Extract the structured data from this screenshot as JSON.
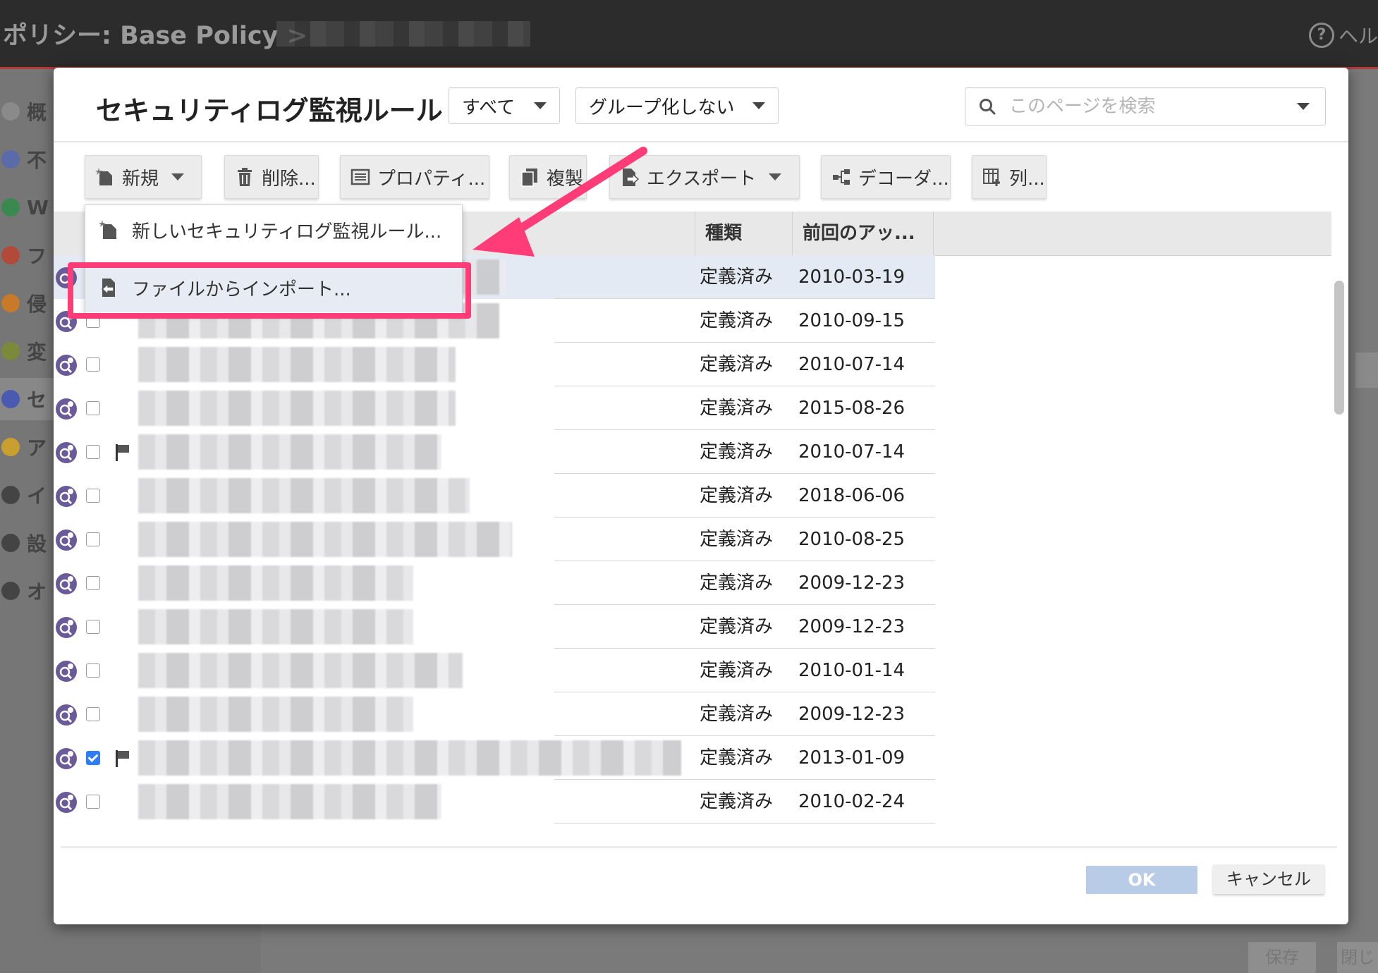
{
  "app": {
    "title": "ポリシー: Base Policy >",
    "help_label": "ヘル",
    "sidebar": [
      {
        "label": "概",
        "color": "#8a8a8a"
      },
      {
        "label": "不",
        "color": "#5b6aa8"
      },
      {
        "label": "W",
        "color": "#3a8a50"
      },
      {
        "label": "フ",
        "color": "#b24a3a"
      },
      {
        "label": "侵",
        "color": "#c77a2a"
      },
      {
        "label": "変",
        "color": "#7a8a3a"
      },
      {
        "label": "セ",
        "color": "#4a5ab0"
      },
      {
        "label": "ア",
        "color": "#c9a030"
      },
      {
        "label": "イ",
        "color": "#444444"
      },
      {
        "label": "設",
        "color": "#444444"
      },
      {
        "label": "オ",
        "color": "#444444"
      }
    ],
    "bottom_buttons": {
      "save": "保存",
      "close": "閉じ"
    }
  },
  "modal": {
    "title": "セキュリティログ監視ルール",
    "filter_label": "すべて",
    "group_label": "グループ化しない",
    "search_placeholder": "このページを検索",
    "toolbar": {
      "new": "新規",
      "delete": "削除...",
      "properties": "プロパティ...",
      "duplicate": "複製",
      "export": "エクスポート",
      "decoder": "デコーダ...",
      "columns": "列..."
    },
    "menu": {
      "new_rule": "新しいセキュリティログ監視ルール...",
      "import_from_file": "ファイルからインポート..."
    },
    "columns": {
      "type": "種類",
      "last_updated": "前回のアッ..."
    },
    "rows": [
      {
        "type": "定義済み",
        "date": "2010-03-19",
        "checked": false,
        "flag": false,
        "selected": true
      },
      {
        "type": "定義済み",
        "date": "2010-09-15",
        "checked": false,
        "flag": false
      },
      {
        "type": "定義済み",
        "date": "2010-07-14",
        "checked": false,
        "flag": false
      },
      {
        "type": "定義済み",
        "date": "2015-08-26",
        "checked": false,
        "flag": false
      },
      {
        "type": "定義済み",
        "date": "2010-07-14",
        "checked": false,
        "flag": true
      },
      {
        "type": "定義済み",
        "date": "2018-06-06",
        "checked": false,
        "flag": false
      },
      {
        "type": "定義済み",
        "date": "2010-08-25",
        "checked": false,
        "flag": false
      },
      {
        "type": "定義済み",
        "date": "2009-12-23",
        "checked": false,
        "flag": false
      },
      {
        "type": "定義済み",
        "date": "2009-12-23",
        "checked": false,
        "flag": false
      },
      {
        "type": "定義済み",
        "date": "2010-01-14",
        "checked": false,
        "flag": false
      },
      {
        "type": "定義済み",
        "date": "2009-12-23",
        "checked": false,
        "flag": false
      },
      {
        "type": "定義済み",
        "date": "2013-01-09",
        "checked": true,
        "flag": true
      },
      {
        "type": "定義済み",
        "date": "2010-02-24",
        "checked": false,
        "flag": false
      }
    ],
    "ok": "OK",
    "cancel": "キャンセル"
  },
  "colors": {
    "accent_annotation": "#ff3b78",
    "ok_button": "#b8cbe7",
    "checkbox_checked": "#2e7cf6"
  }
}
